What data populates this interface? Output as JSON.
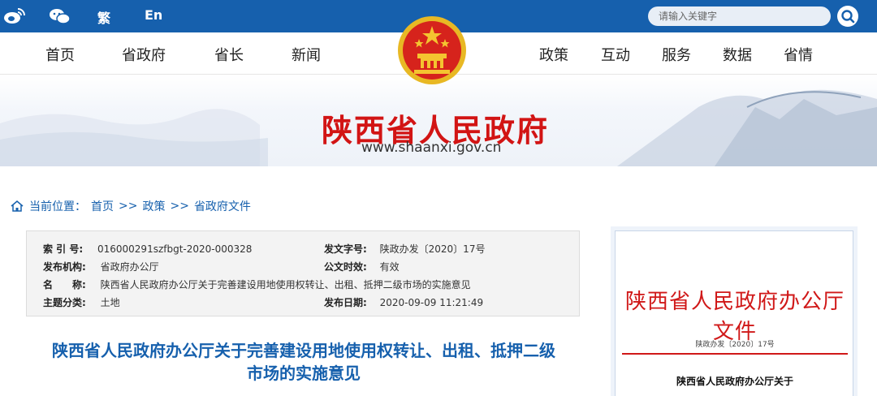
{
  "topbar": {
    "weibo_icon": "weibo-icon",
    "wechat_icon": "wechat-icon",
    "traditional_label": "繁",
    "english_label": "En",
    "search_placeholder": "请输入关键字",
    "search_icon": "search-icon",
    "colors": {
      "bar": "#1660ad"
    }
  },
  "nav": {
    "items": [
      "首页",
      "省政府",
      "省长",
      "新闻",
      "政策",
      "互动",
      "服务",
      "数据",
      "省情"
    ]
  },
  "banner": {
    "title": "陕西省人民政府",
    "url": "www.shaanxi.gov.cn",
    "emblem": "national-emblem",
    "colors": {
      "title": "#d21414"
    }
  },
  "breadcrumb": {
    "icon": "home-icon",
    "prefix": "当前位置：",
    "items": [
      "首页",
      "政策",
      "省政府文件"
    ],
    "separator": ">>"
  },
  "info": {
    "index_label": "索 引 号:",
    "index_value": "016000291szfbgt-2020-000328",
    "doc_no_label": "发文字号:",
    "doc_no_value": "陕政办发〔2020〕17号",
    "issuer_label": "发布机构:",
    "issuer_value": "省政府办公厅",
    "validity_label": "公文时效:",
    "validity_value": "有效",
    "name_label": "名　　称:",
    "name_value": "陕西省人民政府办公厅关于完善建设用地使用权转让、出租、抵押二级市场的实施意见",
    "topic_label": "主题分类:",
    "topic_value": "土地",
    "date_label": "发布日期:",
    "date_value": "2020-09-09 11:21:49"
  },
  "document": {
    "title_line1": "陕西省人民政府办公厅关于完善建设用地使用权转让、出租、抵押二级",
    "title_line2": "市场的实施意见"
  },
  "thumbnail": {
    "header": "陕西省人民政府办公厅文件",
    "number": "陕政办发〔2020〕17号",
    "subtitle": "陕西省人民政府办公厅关于"
  }
}
